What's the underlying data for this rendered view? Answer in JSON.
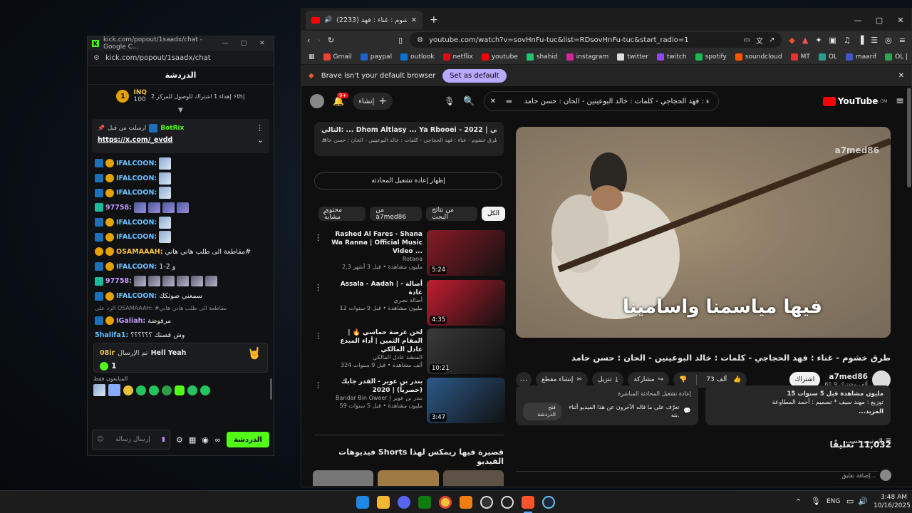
{
  "kick": {
    "window_title": "kick.com/popout/1saadx/chat - Google C...",
    "url": "kick.com/popout/1saadx/chat",
    "header": "الدردشة",
    "leader": {
      "rank": "1",
      "name": "INQ",
      "points": "100",
      "text": "إهداء 1 اشتراك للوصول للمركز 2 ⚡th|"
    },
    "pinned": {
      "label": "ارسلت من قبل",
      "user": "BotRix",
      "link": "https://x.com/_evdd"
    },
    "messages": [
      {
        "user": "IFALCOON:",
        "text": "",
        "kind": "emote1"
      },
      {
        "user": "IFALCOON:",
        "text": "",
        "kind": "emote1"
      },
      {
        "user": "IFALCOON:",
        "text": "",
        "kind": "emote1"
      },
      {
        "user": "97758:",
        "text": "",
        "kind": "emote4"
      },
      {
        "user": "IFALCOON:",
        "text": "",
        "kind": "emote1"
      },
      {
        "user": "IFALCOON:",
        "text": "",
        "kind": "emote1"
      },
      {
        "user": "OSAMAAAH:",
        "text": "مقاطعة الى طلب هاني هاني#",
        "kind": "text"
      },
      {
        "user": "IFALCOON:",
        "text": "و 2-1",
        "kind": "text"
      },
      {
        "user": "97758:",
        "text": "",
        "kind": "emote6"
      },
      {
        "user": "IFALCOON:",
        "text": "سمعني صوتكك",
        "kind": "text"
      }
    ],
    "reply_note": "الرد على OSAMAAAH: #مقاطعة الى طلب هاني هاني",
    "galiah": {
      "user": "IGaliah:",
      "text": "مرفوضة"
    },
    "shalifa": {
      "user": "5halifa1:",
      "text": "وش قصتك ؟؟؟؟؟؟"
    },
    "sub_box": {
      "user": "08ir",
      "mid": "تم الإرسال",
      "text": "Hell Yeah",
      "count": "1"
    },
    "followers_label": "المتابعون فقط",
    "input_placeholder": "إرسال رسالة",
    "send_label": "الدردشة"
  },
  "browser": {
    "tab_title": "(2233) طرق خشوم : غناء : فهد",
    "url": "youtube.com/watch?v=sovHnFu-tuc&list=RDsovHnFu-tuc&start_radio=1",
    "bookmarks": [
      {
        "label": "Gmail",
        "color": "#ea4335"
      },
      {
        "label": "paypal",
        "color": "#1e64c8"
      },
      {
        "label": "outlook",
        "color": "#0a74d4"
      },
      {
        "label": "netflix",
        "color": "#e50914"
      },
      {
        "label": "youtube",
        "color": "#ff0000"
      },
      {
        "label": "shahid",
        "color": "#21c36b"
      },
      {
        "label": "instagram",
        "color": "#d6249f"
      },
      {
        "label": "twitter",
        "color": "#dddddd"
      },
      {
        "label": "twitch",
        "color": "#9146ff"
      },
      {
        "label": "spotify",
        "color": "#1db954"
      },
      {
        "label": "soundcloud",
        "color": "#ff5500"
      },
      {
        "label": "MT",
        "color": "#d33"
      },
      {
        "label": "OL",
        "color": "#2a9d8f"
      },
      {
        "label": "maarif",
        "color": "#4455cc"
      },
      {
        "label": "OL |",
        "color": "#2ea44f"
      }
    ],
    "notice": "Brave isn't your default browser",
    "set_default": "Set as default"
  },
  "youtube": {
    "create_label": "إنشاء",
    "notif_count": "9+",
    "search_query": "طرق خشوم - غناء : فهد الحجاجي - كلمات : خالد البوعينين - الحان : حسن حامد",
    "logo": "YouTube",
    "region": "OM",
    "playlist_title": "التالي: ... Dhom Altlasy ... Ya Rbooei - 2022 | سي ... يا ربوعي",
    "playlist_sub": "ميكس طرق خشوم - غناء : فهد الحجاجي - كلمات : خالد البوعينين - الحان : حسن حامد",
    "chat_replay": "إظهار إعادة تشغيل المحادثة",
    "chips": [
      "الكل",
      "من نتائج البحث",
      "من a7med86",
      "محتوى مشابه"
    ],
    "recs": [
      {
        "title": "Rashed Al Fares - Shana Wa Ranna | Official Music Video ...",
        "channel": "Rotana",
        "meta": "2.3 مليون مشاهدة • قبل 3 أشهر",
        "dur": "5:24",
        "color": "#8a1a25"
      },
      {
        "title": "Assala - Aadah | أصالة - عادة",
        "channel": "أصالة نصري",
        "meta": "12 مليون مشاهدة • قبل 9 سنوات",
        "dur": "4:35",
        "color": "#c41d2f"
      },
      {
        "title": "لحن عرضة حماسي 🔥 | المقام الثمين | أداء المبدع عادل المالكي",
        "channel": "المنشد عادل المالكي",
        "meta": "324 ألف مشاهدة • قبل 9 سنوات",
        "dur": "10:21",
        "color": "#3a3a3a"
      },
      {
        "title": "بندر بن عوير - القدر جابك (حصرياً) | 2020",
        "channel": "Bandar Bin Oweer | بندر بن عوير",
        "meta": "59 مليون مشاهدة • قبل 5 سنوات",
        "dur": "3:47",
        "color": "#2c5a8a"
      }
    ],
    "shorts_title": "فيديوهات Shorts قصيرة فيها ريمكس لهذا الفيديو",
    "video_caption": "فيها مياسمنا واسامينا",
    "watermark": "a7med86",
    "video_title": "طرق خشوم - غناء : فهد الحجاجي - كلمات : خالد البوعينين - الحان : حسن حامد",
    "channel": "a7med86",
    "subs": "61.9 ألف مشترك",
    "subscribe": "اشتراك",
    "likes": "73 ألف",
    "share": "مشاركة",
    "download": "تنزيل",
    "clip": "إنشاء مقطع",
    "desc_views": "15 مليون مشاهدة قبل 5 سنوات",
    "desc_line": "توزيع : مهند سيف * تصميم : أحمد المطاوعة",
    "desc_more": "...المزيد",
    "chat_box_title": "إعادة تشغيل المحادثة المباشرة",
    "chat_box_text": "تعرّف على ما قاله الآخرون عن هذا الفيديو أثناء بثه.",
    "chat_box_btn": "فتح الدردشة",
    "comments_count": "11,032",
    "comments_label": "تعليقًا",
    "sort_label": "الترتيب حسب",
    "add_comment": "إضافة تعليق..."
  },
  "taskbar": {
    "lang": "ENG",
    "time": "3:48 AM",
    "date": "10/16/2025"
  }
}
